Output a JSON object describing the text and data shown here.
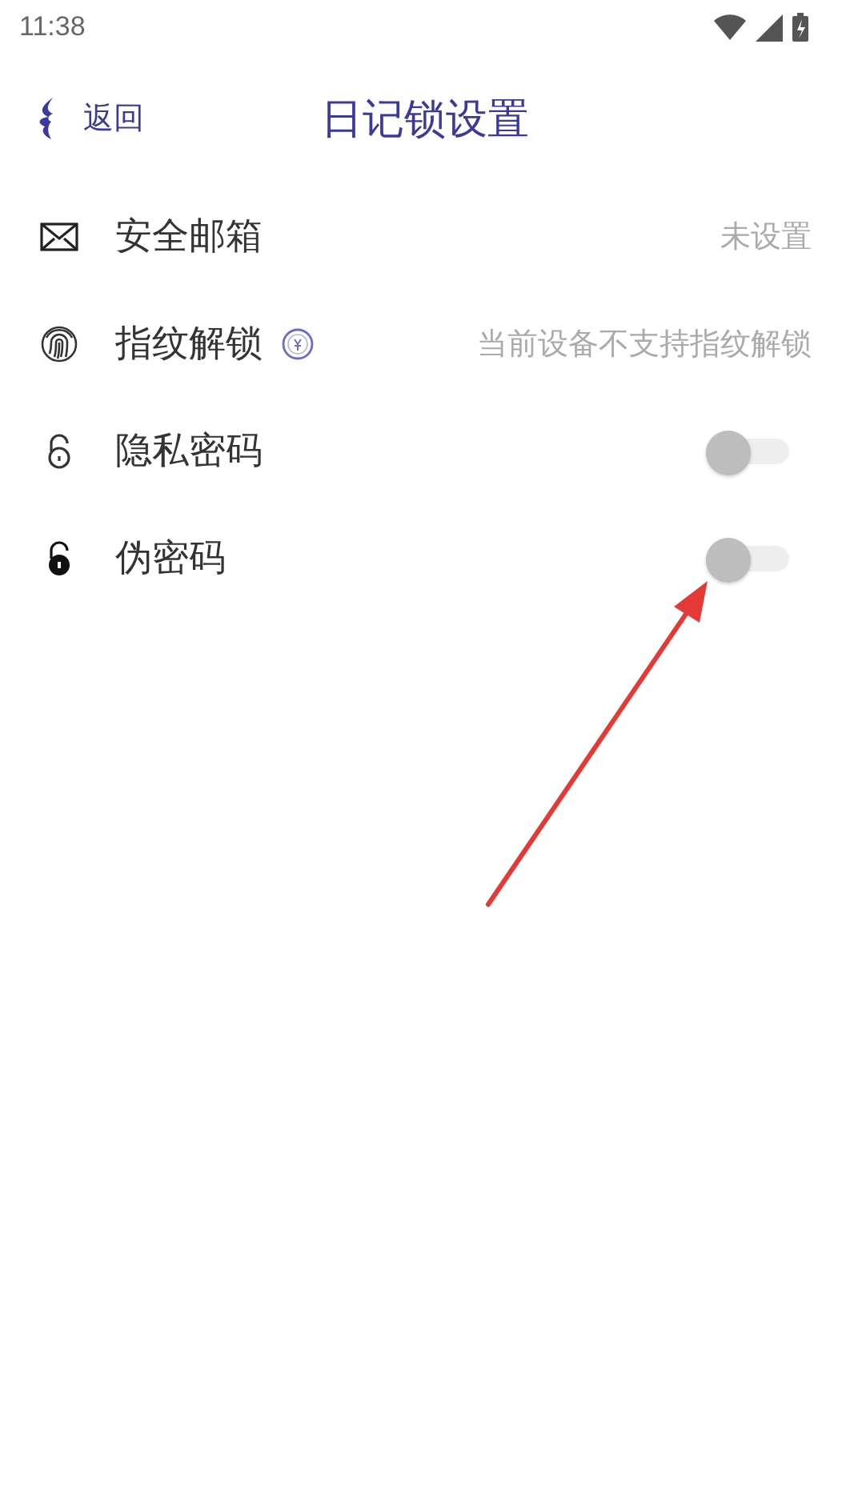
{
  "status_bar": {
    "time": "11:38"
  },
  "header": {
    "back_label": "返回",
    "title": "日记锁设置"
  },
  "settings": [
    {
      "kind": "value",
      "label": "安全邮箱",
      "value": "未设置"
    },
    {
      "kind": "info-value",
      "label": "指纹解锁",
      "value": "当前设备不支持指纹解锁"
    },
    {
      "kind": "switch",
      "label": "隐私密码",
      "on": false
    },
    {
      "kind": "switch",
      "label": "伪密码",
      "on": false
    }
  ],
  "annotation": {
    "kind": "arrow"
  }
}
